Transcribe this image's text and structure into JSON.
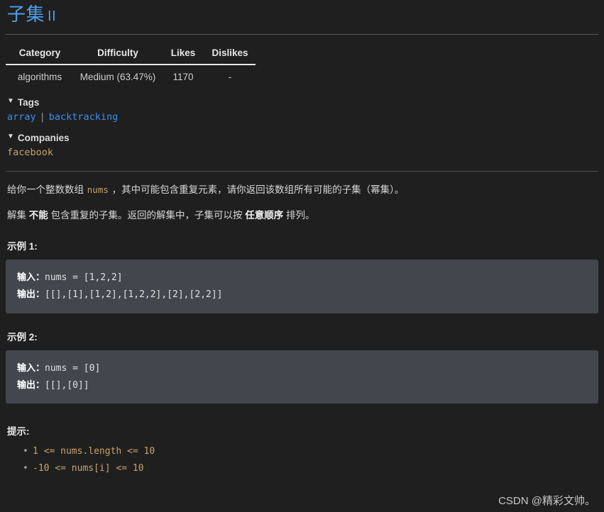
{
  "title": {
    "main": "子集",
    "suffix": "II"
  },
  "meta_table": {
    "headers": [
      "Category",
      "Difficulty",
      "Likes",
      "Dislikes"
    ],
    "rows": [
      {
        "category": "algorithms",
        "difficulty": "Medium (63.47%)",
        "likes": "1170",
        "dislikes": "-"
      }
    ]
  },
  "tags_section": {
    "caret": "▼",
    "heading": "Tags",
    "items": [
      "array",
      "backtracking"
    ],
    "separator": "|"
  },
  "companies_section": {
    "caret": "▼",
    "heading": "Companies",
    "items": [
      "facebook"
    ]
  },
  "description": {
    "para1_before_code": "给你一个整数数组 ",
    "para1_code": "nums",
    "para1_after_code": " ，其中可能包含重复元素，请你返回该数组所有可能的子集（幂集）。",
    "para2_part1": "解集 ",
    "para2_bold1": "不能",
    "para2_part2": " 包含重复的子集。返回的解集中，子集可以按 ",
    "para2_bold2": "任意顺序",
    "para2_part3": " 排列。"
  },
  "examples": [
    {
      "label": "示例 1:",
      "input_label": "输入：",
      "input_value": "nums = [1,2,2]",
      "output_label": "输出：",
      "output_value": "[[],[1],[1,2],[1,2,2],[2],[2,2]]"
    },
    {
      "label": "示例 2:",
      "input_label": "输入：",
      "input_value": "nums = [0]",
      "output_label": "输出：",
      "output_value": "[[],[0]]"
    }
  ],
  "hints": {
    "label": "提示:",
    "items": [
      "1 <= nums.length <= 10",
      "-10 <= nums[i] <= 10"
    ]
  },
  "watermark": "CSDN @精彩文帅。",
  "colors": {
    "background": "#1f1f1f",
    "title_blue": "#4e9eea",
    "tag_blue": "#3b8eea",
    "company_tan": "#c7a26b",
    "code_block_bg": "#43474d",
    "code_tan": "#c7a26b",
    "text": "#d4d4d4"
  }
}
